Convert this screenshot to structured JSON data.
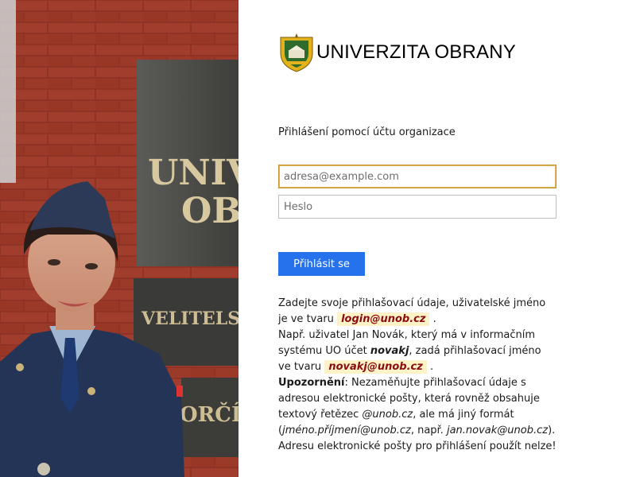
{
  "brand": {
    "name": "UNIVERZITA OBRANY",
    "crest_icon": "university-crest-icon",
    "colors": {
      "gold": "#e3b21a",
      "green": "#2f6b2a",
      "blue": "#2672ec"
    }
  },
  "photo": {
    "description_icon": "photo-soldier-at-building",
    "plaque_lines": [
      "UNIV",
      "OB"
    ],
    "sign_text": "VELITELSTV",
    "lower_text": "ORČÍ"
  },
  "login": {
    "heading": "Přihlášení pomocí účtu organizace",
    "email_placeholder": "adresa@example.com",
    "password_placeholder": "Heslo",
    "submit_label": "Přihlásit se"
  },
  "help": {
    "p1_pre": "Zadejte svoje přihlašovací údaje, uživatelské jméno je ve tvaru",
    "p1_example": "login@unob.cz",
    "p1_post": ".",
    "p2_pre": "Např. uživatel Jan Novák, který má v informačním systému UO účet",
    "p2_account": "novakj",
    "p2_mid": ", zadá přihlašovací jméno ve tvaru",
    "p2_example": "novakj@unob.cz",
    "p2_post": ".",
    "warning_label": "Upozornění",
    "warning_text_1": ": Nezaměňujte přihlašovací údaje s adresou elektronické pošty, která rovněž obsahuje textový řetězec",
    "warning_domain": "@unob.cz",
    "warning_text_2": ", ale má jiný formát (",
    "warning_format": "jméno.příjmení@unob.cz",
    "warning_text_3": ", např.",
    "warning_sample": "jan.novak@unob.cz",
    "warning_text_4": ").",
    "p3": "Adresu elektronické pošty pro přihlášení použít nelze!"
  }
}
